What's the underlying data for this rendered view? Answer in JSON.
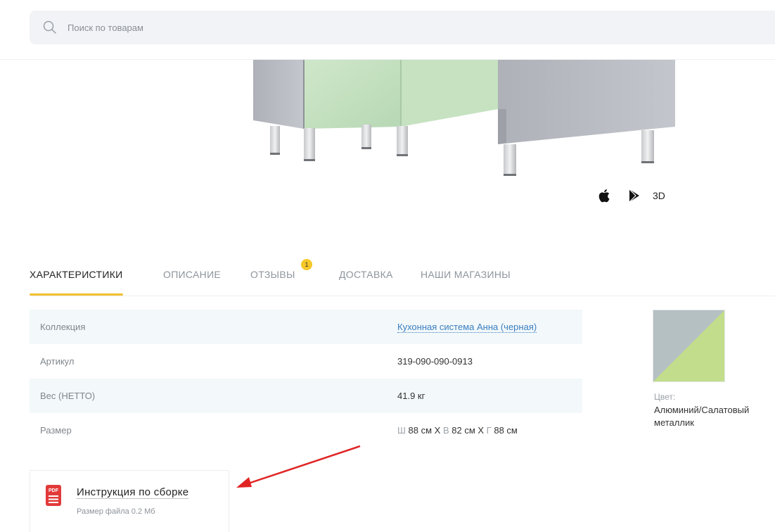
{
  "search": {
    "placeholder": "Поиск по товарам",
    "icon": "search-icon"
  },
  "app_links": {
    "icons": [
      "apple-icon",
      "google-play-icon"
    ],
    "label_3d": "3D"
  },
  "tabs": [
    {
      "label": "ХАРАКТЕРИСТИКИ",
      "active": true
    },
    {
      "label": "ОПИСАНИЕ",
      "active": false
    },
    {
      "label": "ОТЗЫВЫ",
      "active": false,
      "badge": "1"
    },
    {
      "label": "ДОСТАВКА",
      "active": false
    },
    {
      "label": "НАШИ МАГАЗИНЫ",
      "active": false
    }
  ],
  "specs": [
    {
      "label": "Коллекция",
      "value": "Кухонная система Анна (черная)",
      "is_link": true
    },
    {
      "label": "Артикул",
      "value": "319-090-090-0913"
    },
    {
      "label": "Вес (НЕТТО)",
      "value": "41.9 кг"
    },
    {
      "label": "Размер",
      "value_parts": {
        "w_letter": "Ш",
        "w_value": "88 см X",
        "h_letter": "В",
        "h_value": "82 см X",
        "d_letter": "Г",
        "d_value": "88 см"
      }
    }
  ],
  "color": {
    "label": "Цвет:",
    "value": "Алюминий/Салатовый металлик",
    "swatch_colors": [
      "#b5c0c3",
      "#c2dd8b"
    ]
  },
  "instruction": {
    "title": "Инструкция по сборке",
    "size": "Размер файла 0.2 Мб",
    "icon_text": "PDF",
    "icon_color": "#e23a3a"
  },
  "colors": {
    "accent": "#f2c02f",
    "link": "#3a7fc1",
    "annotation_arrow": "#e02424"
  }
}
